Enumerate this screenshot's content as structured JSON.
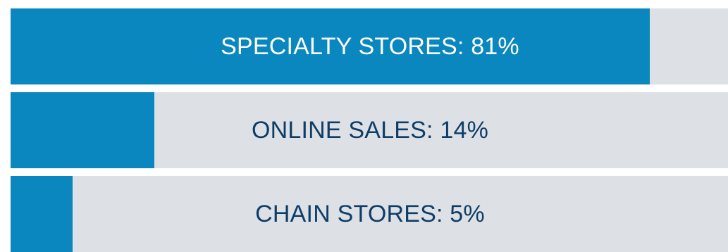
{
  "chart_data": {
    "type": "bar",
    "orientation": "horizontal",
    "title": "",
    "categories": [
      "SPECIALTY STORES",
      "ONLINE SALES",
      "CHAIN STORES"
    ],
    "values": [
      81,
      14,
      5
    ],
    "labels": [
      "SPECIALTY STORES:  81%",
      "ONLINE SALES: 14%",
      "CHAIN STORES: 5%"
    ],
    "unit": "%",
    "xlim": [
      0,
      100
    ],
    "grid": false,
    "legend": "none"
  },
  "colors": {
    "fill": "#0a87bf",
    "track": "#dde1e5",
    "label_on_fill": "#ffffff",
    "label_on_track": "#0f3d66"
  }
}
